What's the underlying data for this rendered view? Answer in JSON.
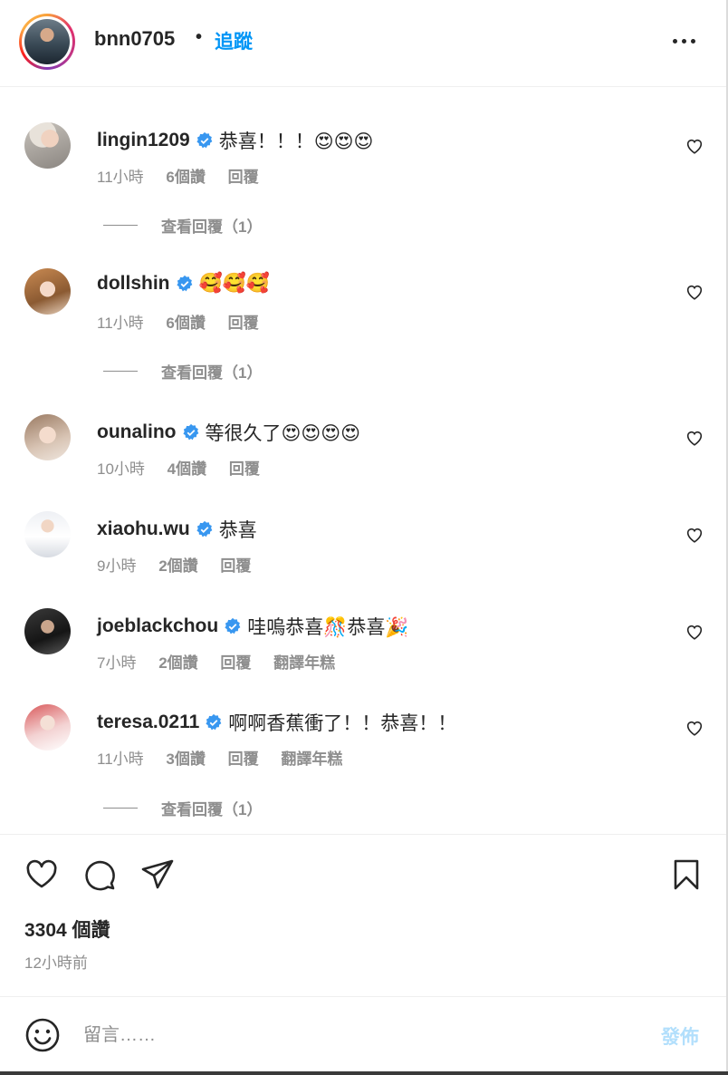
{
  "header": {
    "username": "bnn0705",
    "separator": "•",
    "follow_label": "追蹤"
  },
  "comments": [
    {
      "username": "lingin1209",
      "text": "恭喜！！！😍😍😍",
      "time": "11小時",
      "likes": "6個讚",
      "reply": "回覆",
      "translate": "",
      "view_replies": "查看回覆（1）"
    },
    {
      "username": "dollshin",
      "text": "🥰🥰🥰",
      "time": "11小時",
      "likes": "6個讚",
      "reply": "回覆",
      "translate": "",
      "view_replies": "查看回覆（1）"
    },
    {
      "username": "ounalino",
      "text": "等很久了😍😍😍😍",
      "time": "10小時",
      "likes": "4個讚",
      "reply": "回覆",
      "translate": "",
      "view_replies": ""
    },
    {
      "username": "xiaohu.wu",
      "text": "恭喜",
      "time": "9小時",
      "likes": "2個讚",
      "reply": "回覆",
      "translate": "",
      "view_replies": ""
    },
    {
      "username": "joeblackchou",
      "text": "哇嗚恭喜🎊恭喜🎉",
      "time": "7小時",
      "likes": "2個讚",
      "reply": "回覆",
      "translate": "翻譯年糕",
      "view_replies": ""
    },
    {
      "username": "teresa.0211",
      "text": "啊啊香蕉衝了！！恭喜！！",
      "time": "11小時",
      "likes": "3個讚",
      "reply": "回覆",
      "translate": "翻譯年糕",
      "view_replies": "查看回覆（1）"
    }
  ],
  "post": {
    "likes_count": "3304 個讚",
    "time_ago": "12小時前"
  },
  "compose": {
    "placeholder": "留言……",
    "post_label": "發佈"
  },
  "colors": {
    "accent": "#0095f6",
    "verified": "#3897f0",
    "muted": "#8e8e8e",
    "post_disabled": "#b2dffc"
  },
  "icons": [
    "more-options-icon",
    "verified-badge-icon",
    "heart-icon",
    "comment-icon",
    "share-icon",
    "bookmark-icon",
    "emoji-icon"
  ]
}
